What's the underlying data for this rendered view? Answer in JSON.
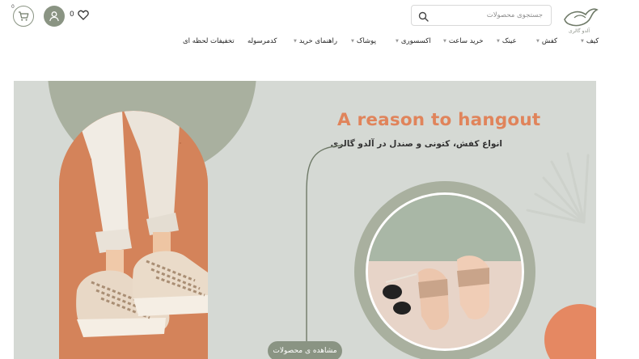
{
  "header": {
    "logo_text": "آلدو گالری",
    "search_placeholder": "جستجوی محصولات",
    "wishlist_count": "0",
    "cart_count": "0"
  },
  "nav": {
    "items": [
      {
        "label": "کیف",
        "has_dropdown": true
      },
      {
        "label": "کفش",
        "has_dropdown": true
      },
      {
        "label": "عینک",
        "has_dropdown": true
      },
      {
        "label": "خرید ساعت",
        "has_dropdown": true
      },
      {
        "label": "اکسسوری",
        "has_dropdown": true
      },
      {
        "label": "پوشاک",
        "has_dropdown": true
      },
      {
        "label": "راهنمای خرید",
        "has_dropdown": true
      },
      {
        "label": "کدمرسوله",
        "has_dropdown": false
      },
      {
        "label": "تخفیفات لحظه ای",
        "has_dropdown": false
      }
    ]
  },
  "hero": {
    "title": "A reason to hangout",
    "subtitle": "انواع کفش، کتونی و صندل در آلدو گالری",
    "cta_label": "مشاهده ی محصولات"
  },
  "colors": {
    "accent_orange": "#e0845b",
    "sage_green": "#8a9483",
    "hero_background": "#d5d9d4"
  },
  "icons": {
    "logo": "bird-logo-icon",
    "search": "search-icon",
    "wishlist": "heart-icon",
    "account": "user-icon",
    "cart": "cart-icon"
  }
}
